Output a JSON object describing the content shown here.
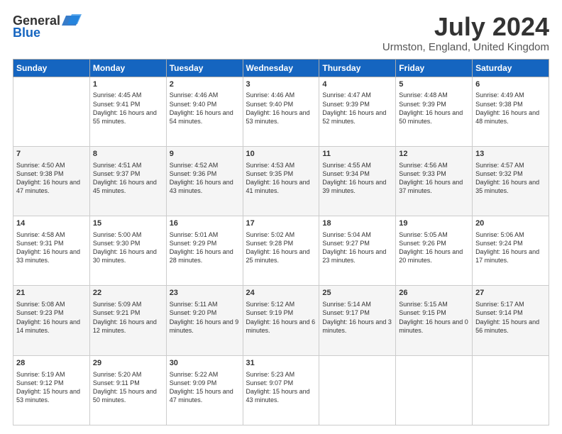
{
  "logo": {
    "general": "General",
    "blue": "Blue"
  },
  "title": "July 2024",
  "subtitle": "Urmston, England, United Kingdom",
  "days_header": [
    "Sunday",
    "Monday",
    "Tuesday",
    "Wednesday",
    "Thursday",
    "Friday",
    "Saturday"
  ],
  "weeks": [
    [
      {
        "day": null,
        "content": null
      },
      {
        "day": "1",
        "sunrise": "Sunrise: 4:45 AM",
        "sunset": "Sunset: 9:41 PM",
        "daylight": "Daylight: 16 hours and 55 minutes."
      },
      {
        "day": "2",
        "sunrise": "Sunrise: 4:46 AM",
        "sunset": "Sunset: 9:40 PM",
        "daylight": "Daylight: 16 hours and 54 minutes."
      },
      {
        "day": "3",
        "sunrise": "Sunrise: 4:46 AM",
        "sunset": "Sunset: 9:40 PM",
        "daylight": "Daylight: 16 hours and 53 minutes."
      },
      {
        "day": "4",
        "sunrise": "Sunrise: 4:47 AM",
        "sunset": "Sunset: 9:39 PM",
        "daylight": "Daylight: 16 hours and 52 minutes."
      },
      {
        "day": "5",
        "sunrise": "Sunrise: 4:48 AM",
        "sunset": "Sunset: 9:39 PM",
        "daylight": "Daylight: 16 hours and 50 minutes."
      },
      {
        "day": "6",
        "sunrise": "Sunrise: 4:49 AM",
        "sunset": "Sunset: 9:38 PM",
        "daylight": "Daylight: 16 hours and 48 minutes."
      }
    ],
    [
      {
        "day": "7",
        "sunrise": "Sunrise: 4:50 AM",
        "sunset": "Sunset: 9:38 PM",
        "daylight": "Daylight: 16 hours and 47 minutes."
      },
      {
        "day": "8",
        "sunrise": "Sunrise: 4:51 AM",
        "sunset": "Sunset: 9:37 PM",
        "daylight": "Daylight: 16 hours and 45 minutes."
      },
      {
        "day": "9",
        "sunrise": "Sunrise: 4:52 AM",
        "sunset": "Sunset: 9:36 PM",
        "daylight": "Daylight: 16 hours and 43 minutes."
      },
      {
        "day": "10",
        "sunrise": "Sunrise: 4:53 AM",
        "sunset": "Sunset: 9:35 PM",
        "daylight": "Daylight: 16 hours and 41 minutes."
      },
      {
        "day": "11",
        "sunrise": "Sunrise: 4:55 AM",
        "sunset": "Sunset: 9:34 PM",
        "daylight": "Daylight: 16 hours and 39 minutes."
      },
      {
        "day": "12",
        "sunrise": "Sunrise: 4:56 AM",
        "sunset": "Sunset: 9:33 PM",
        "daylight": "Daylight: 16 hours and 37 minutes."
      },
      {
        "day": "13",
        "sunrise": "Sunrise: 4:57 AM",
        "sunset": "Sunset: 9:32 PM",
        "daylight": "Daylight: 16 hours and 35 minutes."
      }
    ],
    [
      {
        "day": "14",
        "sunrise": "Sunrise: 4:58 AM",
        "sunset": "Sunset: 9:31 PM",
        "daylight": "Daylight: 16 hours and 33 minutes."
      },
      {
        "day": "15",
        "sunrise": "Sunrise: 5:00 AM",
        "sunset": "Sunset: 9:30 PM",
        "daylight": "Daylight: 16 hours and 30 minutes."
      },
      {
        "day": "16",
        "sunrise": "Sunrise: 5:01 AM",
        "sunset": "Sunset: 9:29 PM",
        "daylight": "Daylight: 16 hours and 28 minutes."
      },
      {
        "day": "17",
        "sunrise": "Sunrise: 5:02 AM",
        "sunset": "Sunset: 9:28 PM",
        "daylight": "Daylight: 16 hours and 25 minutes."
      },
      {
        "day": "18",
        "sunrise": "Sunrise: 5:04 AM",
        "sunset": "Sunset: 9:27 PM",
        "daylight": "Daylight: 16 hours and 23 minutes."
      },
      {
        "day": "19",
        "sunrise": "Sunrise: 5:05 AM",
        "sunset": "Sunset: 9:26 PM",
        "daylight": "Daylight: 16 hours and 20 minutes."
      },
      {
        "day": "20",
        "sunrise": "Sunrise: 5:06 AM",
        "sunset": "Sunset: 9:24 PM",
        "daylight": "Daylight: 16 hours and 17 minutes."
      }
    ],
    [
      {
        "day": "21",
        "sunrise": "Sunrise: 5:08 AM",
        "sunset": "Sunset: 9:23 PM",
        "daylight": "Daylight: 16 hours and 14 minutes."
      },
      {
        "day": "22",
        "sunrise": "Sunrise: 5:09 AM",
        "sunset": "Sunset: 9:21 PM",
        "daylight": "Daylight: 16 hours and 12 minutes."
      },
      {
        "day": "23",
        "sunrise": "Sunrise: 5:11 AM",
        "sunset": "Sunset: 9:20 PM",
        "daylight": "Daylight: 16 hours and 9 minutes."
      },
      {
        "day": "24",
        "sunrise": "Sunrise: 5:12 AM",
        "sunset": "Sunset: 9:19 PM",
        "daylight": "Daylight: 16 hours and 6 minutes."
      },
      {
        "day": "25",
        "sunrise": "Sunrise: 5:14 AM",
        "sunset": "Sunset: 9:17 PM",
        "daylight": "Daylight: 16 hours and 3 minutes."
      },
      {
        "day": "26",
        "sunrise": "Sunrise: 5:15 AM",
        "sunset": "Sunset: 9:15 PM",
        "daylight": "Daylight: 16 hours and 0 minutes."
      },
      {
        "day": "27",
        "sunrise": "Sunrise: 5:17 AM",
        "sunset": "Sunset: 9:14 PM",
        "daylight": "Daylight: 15 hours and 56 minutes."
      }
    ],
    [
      {
        "day": "28",
        "sunrise": "Sunrise: 5:19 AM",
        "sunset": "Sunset: 9:12 PM",
        "daylight": "Daylight: 15 hours and 53 minutes."
      },
      {
        "day": "29",
        "sunrise": "Sunrise: 5:20 AM",
        "sunset": "Sunset: 9:11 PM",
        "daylight": "Daylight: 15 hours and 50 minutes."
      },
      {
        "day": "30",
        "sunrise": "Sunrise: 5:22 AM",
        "sunset": "Sunset: 9:09 PM",
        "daylight": "Daylight: 15 hours and 47 minutes."
      },
      {
        "day": "31",
        "sunrise": "Sunrise: 5:23 AM",
        "sunset": "Sunset: 9:07 PM",
        "daylight": "Daylight: 15 hours and 43 minutes."
      },
      {
        "day": null,
        "content": null
      },
      {
        "day": null,
        "content": null
      },
      {
        "day": null,
        "content": null
      }
    ]
  ]
}
